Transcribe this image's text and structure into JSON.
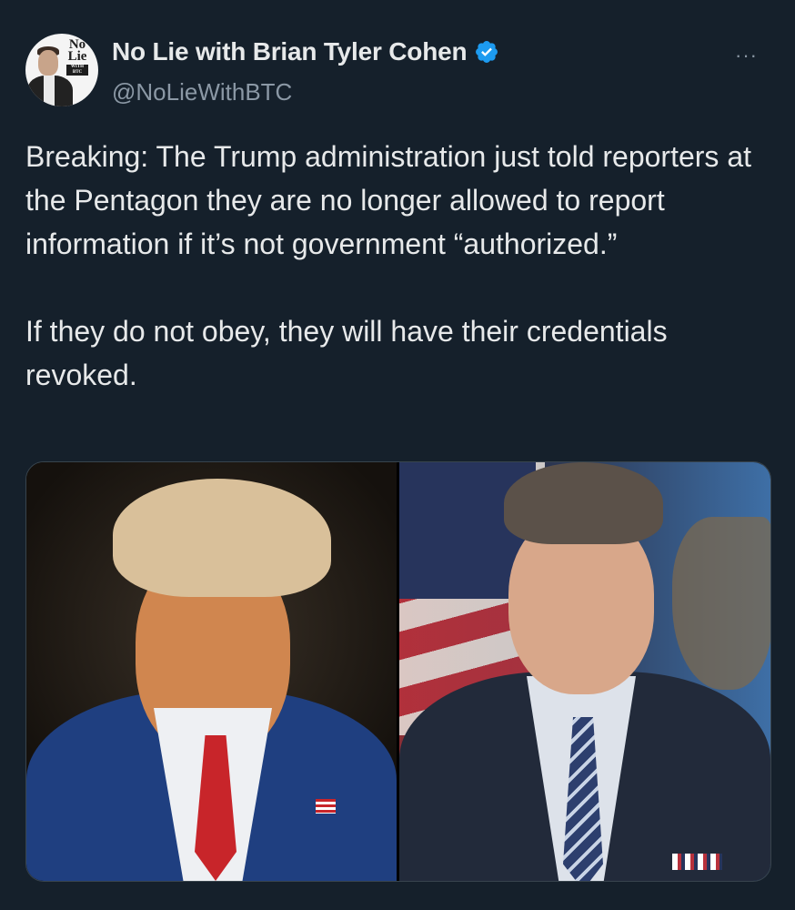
{
  "tweet": {
    "author": {
      "display_name": "No Lie with Brian Tyler Cohen",
      "handle": "@NoLieWithBTC",
      "verified": true,
      "avatar_logo_line1": "No",
      "avatar_logo_line2": "Lie",
      "avatar_logo_sub": "WITH BTC"
    },
    "more_options_label": "···",
    "text": "Breaking: The Trump administration just told reporters at the Pentagon they are no longer allowed to report information if it’s not government “authorized.”\n\nIf they do not obey, they will have their credentials revoked.",
    "media": [
      {
        "kind": "photo",
        "subject": "portrait-left"
      },
      {
        "kind": "photo",
        "subject": "portrait-right"
      }
    ]
  },
  "colors": {
    "background": "#15202b",
    "text": "#e7e9ea",
    "secondary_text": "#8b98a5",
    "verified_badge": "#1d9bf0"
  },
  "icons": {
    "verified": "verified-badge-icon",
    "more": "more-options-icon"
  }
}
